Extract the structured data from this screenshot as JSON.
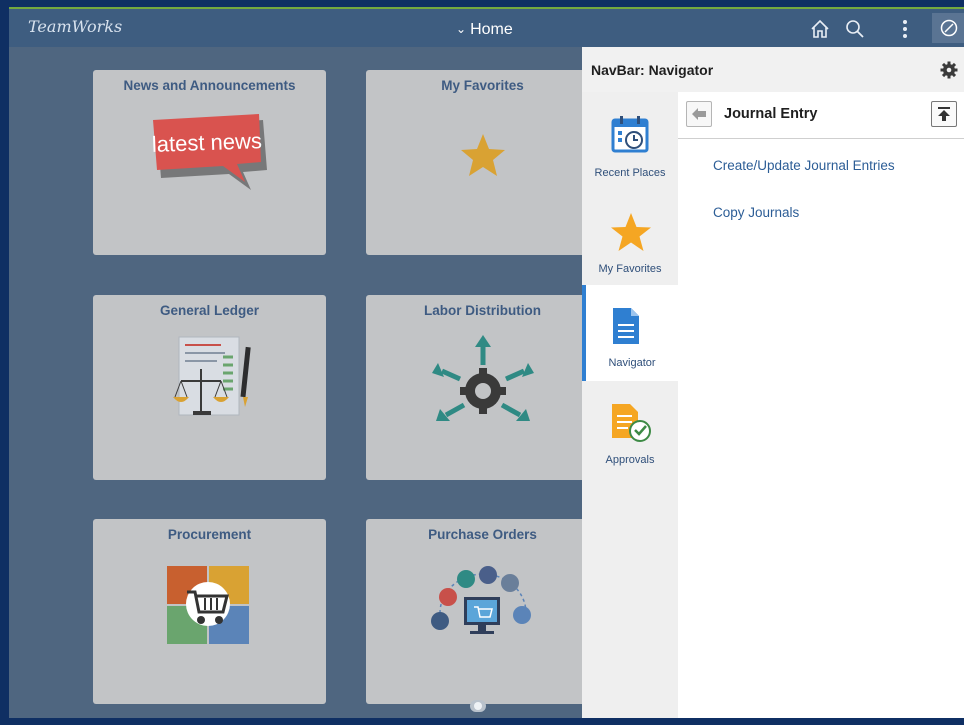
{
  "app": {
    "brand": "TeamWorks",
    "home_label": "Home"
  },
  "topbar": {
    "icons": [
      "home-icon",
      "search-icon",
      "kebab-menu-icon",
      "navbar-compass-icon"
    ]
  },
  "tiles": [
    {
      "title": "News and Announcements",
      "icon": "latest-news-icon",
      "icon_text": "latest news"
    },
    {
      "title": "My Favorites",
      "icon": "star-icon"
    },
    {
      "title": "General Ledger",
      "icon": "ledger-scale-icon"
    },
    {
      "title": "Labor Distribution",
      "icon": "gear-arrows-icon"
    },
    {
      "title": "Procurement",
      "icon": "shopping-cart-icon"
    },
    {
      "title": "Purchase Orders",
      "icon": "purchase-cycle-icon"
    }
  ],
  "navbar": {
    "title": "NavBar: Navigator",
    "items": [
      {
        "label": "Recent Places",
        "icon": "calendar-clock-icon"
      },
      {
        "label": "My Favorites",
        "icon": "star-icon"
      },
      {
        "label": "Navigator",
        "icon": "document-icon",
        "selected": true
      },
      {
        "label": "Approvals",
        "icon": "approvals-icon"
      }
    ],
    "breadcrumb": "Journal Entry",
    "links": [
      "Create/Update Journal Entries",
      "Copy Journals"
    ]
  },
  "colors": {
    "accent": "#2f7fd1",
    "topbar": "#3e5d80",
    "link": "#2c5d96",
    "tile": "#c2c4c6",
    "backdrop": "#4f6680",
    "green_rule": "#74a83f"
  }
}
